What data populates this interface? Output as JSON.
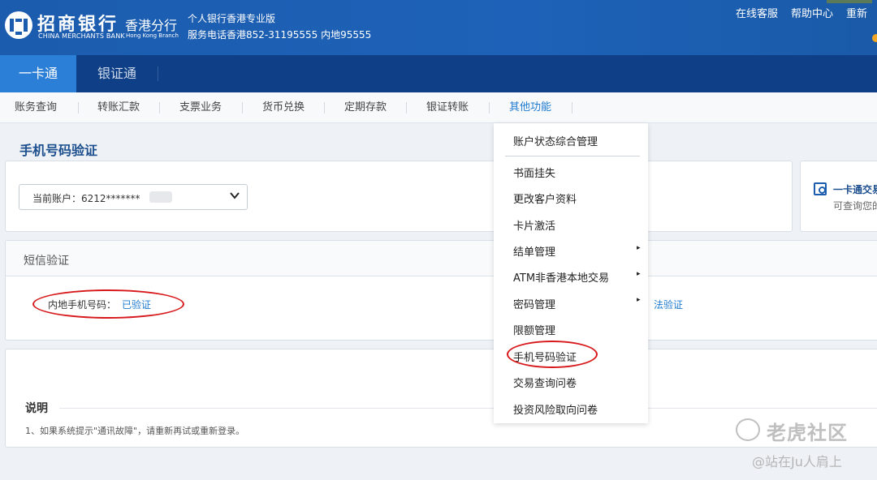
{
  "header": {
    "bank_name_cn": "招商银行",
    "bank_name_en": "CHINA MERCHANTS BANK",
    "branch_cn": "香港分行",
    "branch_en": "Hong Kong Branch",
    "version": "个人银行香港专业版",
    "phone": "服务电话香港852-31195555 内地95555",
    "links": [
      "在线客服",
      "帮助中心",
      "重新"
    ]
  },
  "nav": {
    "tabs": [
      "一卡通",
      "银证通"
    ],
    "active_tab": "一卡通"
  },
  "subnav": {
    "items": [
      "账务查询",
      "转账汇款",
      "支票业务",
      "货币兑换",
      "定期存款",
      "银证转账",
      "其他功能"
    ],
    "active": "其他功能"
  },
  "page": {
    "title": "手机号码验证"
  },
  "account_panel": {
    "current_account": "当前账户：6212*******"
  },
  "side_card": {
    "title": "一卡通交易",
    "subtitle": "可查询您的"
  },
  "sms_panel": {
    "header": "短信验证",
    "mobile_label": "内地手机号码：",
    "mobile_status": "已验证",
    "right_link": "法验证"
  },
  "notes_panel": {
    "title": "说明",
    "items": [
      "1、如果系统提示\"通讯故障\"，请重新再试或重新登录。"
    ]
  },
  "dropdown_menu": {
    "items": [
      "账户状态综合管理",
      "书面挂失",
      "更改客户资料",
      "卡片激活",
      "结单管理",
      "ATM非香港本地交易",
      "密码管理",
      "限额管理",
      "手机号码验证",
      "交易查询问卷",
      "投资风险取向问卷"
    ],
    "has_submenu": [
      "结单管理",
      "ATM非香港本地交易",
      "密码管理"
    ],
    "arrow": "▸"
  },
  "watermark": {
    "brand": "老虎社区",
    "user": "@站在Ju人肩上"
  },
  "colors": {
    "header_blue": "#1c5cae",
    "nav_dark": "#0f3f86",
    "tab_active": "#2b7fd6",
    "link_blue": "#1f7bd0",
    "highlight_red": "#d7191c"
  }
}
